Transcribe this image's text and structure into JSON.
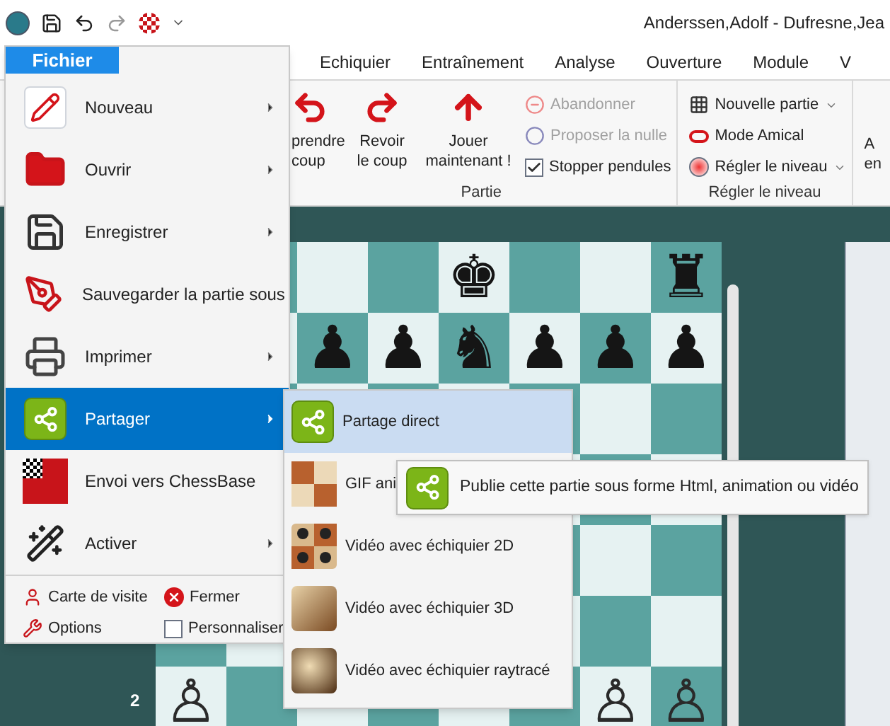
{
  "title_bar": {
    "title": "Anderssen,Adolf - Dufresne,Jea"
  },
  "ribbon_tabs": [
    {
      "label": "Echiquier",
      "selected": false
    },
    {
      "label": "Entraînement",
      "selected": false
    },
    {
      "label": "Analyse",
      "selected": false
    },
    {
      "label": "Ouverture",
      "selected": false
    },
    {
      "label": "Module",
      "selected": false
    },
    {
      "label": "V",
      "selected": false
    }
  ],
  "ribbon_groups": [
    {
      "label": "Partie",
      "large_buttons": [
        {
          "lines": [
            "prendre",
            "coup"
          ]
        },
        {
          "lines": [
            "Revoir",
            "le coup"
          ]
        },
        {
          "lines": [
            "Jouer",
            "maintenant !"
          ]
        }
      ],
      "small_items": [
        {
          "kind": "action",
          "label": "Abandonner",
          "disabled": true
        },
        {
          "kind": "action",
          "label": "Proposer la nulle",
          "disabled": true
        },
        {
          "kind": "checkbox",
          "label": "Stopper pendules",
          "checked": true
        }
      ]
    },
    {
      "label": "Régler le niveau",
      "small_items": [
        {
          "kind": "dropdown",
          "label": "Nouvelle partie",
          "disabled": false
        },
        {
          "kind": "action",
          "label": "Mode Amical",
          "disabled": false
        },
        {
          "kind": "dropdown",
          "label": "Régler le niveau",
          "disabled": false
        }
      ]
    }
  ],
  "ribbon_cut_lines": [
    "A",
    "en"
  ],
  "board": {
    "rank_label": "2",
    "ranks": [
      [
        {
          "kind": "empty"
        },
        {
          "kind": "empty"
        },
        {
          "kind": "empty"
        },
        {
          "kind": "empty"
        },
        {
          "kind": "black",
          "glyph": "♚"
        },
        {
          "kind": "empty"
        },
        {
          "kind": "empty"
        },
        {
          "kind": "black",
          "glyph": "♜"
        }
      ],
      [
        {
          "kind": "empty"
        },
        {
          "kind": "empty"
        },
        {
          "kind": "black",
          "glyph": "♟"
        },
        {
          "kind": "black",
          "glyph": "♟"
        },
        {
          "kind": "black",
          "glyph": "♞"
        },
        {
          "kind": "black",
          "glyph": "♟"
        },
        {
          "kind": "black",
          "glyph": "♟"
        },
        {
          "kind": "black",
          "glyph": "♟"
        }
      ],
      [
        {
          "kind": "empty"
        },
        {
          "kind": "empty"
        },
        {
          "kind": "empty"
        },
        {
          "kind": "empty"
        },
        {
          "kind": "empty"
        },
        {
          "kind": "empty"
        },
        {
          "kind": "empty"
        },
        {
          "kind": "empty"
        }
      ],
      [
        {
          "kind": "empty"
        },
        {
          "kind": "empty"
        },
        {
          "kind": "empty"
        },
        {
          "kind": "empty"
        },
        {
          "kind": "empty"
        },
        {
          "kind": "empty"
        },
        {
          "kind": "empty"
        },
        {
          "kind": "empty"
        }
      ],
      [
        {
          "kind": "empty"
        },
        {
          "kind": "empty"
        },
        {
          "kind": "empty"
        },
        {
          "kind": "empty"
        },
        {
          "kind": "empty"
        },
        {
          "kind": "empty"
        },
        {
          "kind": "empty"
        },
        {
          "kind": "empty"
        }
      ],
      [
        {
          "kind": "empty"
        },
        {
          "kind": "empty"
        },
        {
          "kind": "empty"
        },
        {
          "kind": "empty"
        },
        {
          "kind": "empty"
        },
        {
          "kind": "empty"
        },
        {
          "kind": "empty"
        },
        {
          "kind": "empty"
        }
      ],
      [
        {
          "kind": "white",
          "glyph": "♙"
        },
        {
          "kind": "empty"
        },
        {
          "kind": "empty"
        },
        {
          "kind": "empty"
        },
        {
          "kind": "empty"
        },
        {
          "kind": "empty"
        },
        {
          "kind": "white",
          "glyph": "♙"
        },
        {
          "kind": "white",
          "glyph": "♙"
        }
      ]
    ]
  },
  "file_menu": {
    "tab": "Fichier",
    "items": [
      {
        "label": "Nouveau",
        "submenu": true,
        "selected": false
      },
      {
        "label": "Ouvrir",
        "submenu": true,
        "selected": false
      },
      {
        "label": "Enregistrer",
        "submenu": true,
        "selected": false
      },
      {
        "label": "Sauvegarder la partie sous",
        "submenu": false,
        "selected": false
      },
      {
        "label": "Imprimer",
        "submenu": true,
        "selected": false
      },
      {
        "label": "Partager",
        "submenu": true,
        "selected": true
      },
      {
        "label": "Envoi vers ChessBase",
        "submenu": false,
        "selected": false
      },
      {
        "label": "Activer",
        "submenu": true,
        "selected": false
      }
    ],
    "footer": [
      {
        "label": "Carte de visite"
      },
      {
        "label": "Fermer"
      },
      {
        "label": "Options"
      },
      {
        "label": "Personnaliser"
      }
    ]
  },
  "share_submenu": {
    "items": [
      {
        "label": "Partage direct",
        "selected": true
      },
      {
        "label": "GIF ani",
        "selected": false
      },
      {
        "label": "Vidéo avec échiquier 2D",
        "selected": false
      },
      {
        "label": "Vidéo avec échiquier 3D",
        "selected": false
      },
      {
        "label": "Vidéo avec échiquier raytracé",
        "selected": false
      }
    ]
  },
  "tooltip": {
    "text": "Publie cette partie sous forme Html, animation ou vidéo"
  }
}
